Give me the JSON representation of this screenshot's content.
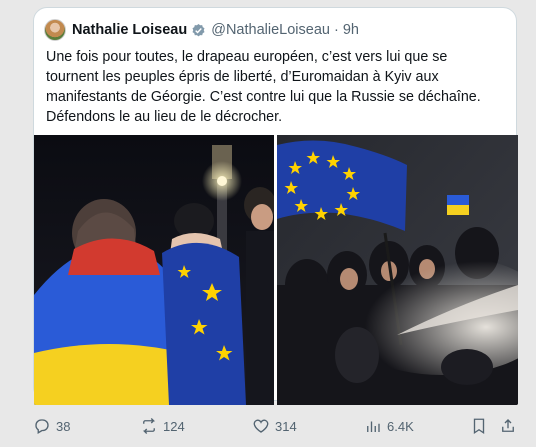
{
  "tweet": {
    "author_name": "Nathalie Loiseau",
    "author_handle": "@NathalieLoiseau",
    "separator": "·",
    "time": "9h",
    "text": "Une fois pour toutes, le drapeau européen, c’est vers lui que se tournent les peuples épris de liberté, d’Euromaidan à Kyiv aux manifestants de Géorgie. C’est contre lui que la Russie se déchaîne. Défendons le au lieu de le décrocher."
  },
  "actions": {
    "replies": "38",
    "reposts": "124",
    "likes": "314",
    "views": "6.4K"
  },
  "icons": {
    "verified": "verified-badge-icon",
    "reply": "reply-icon",
    "repost": "repost-icon",
    "like": "heart-icon",
    "views": "views-chart-icon",
    "bookmark": "bookmark-icon",
    "share": "share-icon"
  },
  "colors": {
    "text": "#0f1419",
    "secondary": "#536471",
    "border": "#cfd9de",
    "eu_blue": "#1f3fa6",
    "eu_yellow": "#ffd200",
    "ukraine_blue": "#2a5bd7",
    "ukraine_yellow": "#f5d020"
  }
}
